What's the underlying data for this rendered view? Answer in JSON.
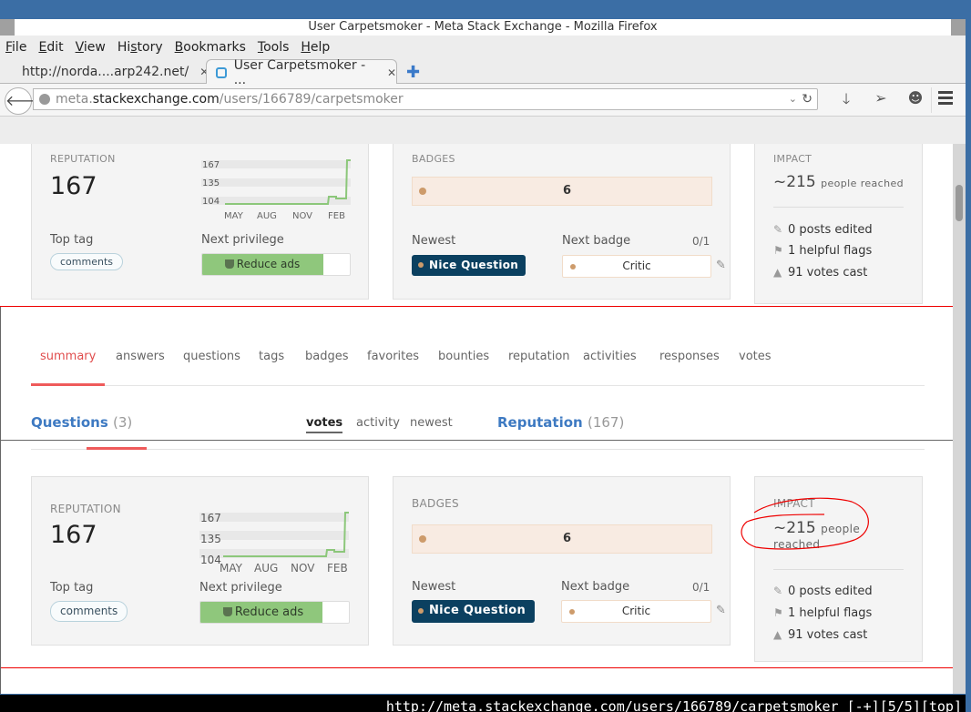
{
  "window": {
    "title": "User Carpetsmoker - Meta Stack Exchange - Mozilla Firefox"
  },
  "menubar": {
    "items": [
      {
        "label": "File",
        "mnemonic": "F",
        "rest": "ile"
      },
      {
        "label": "Edit",
        "mnemonic": "E",
        "rest": "dit"
      },
      {
        "label": "View",
        "mnemonic": "V",
        "rest": "iew"
      },
      {
        "label": "History",
        "pre": "Hi",
        "mnemonic": "s",
        "rest": "tory"
      },
      {
        "label": "Bookmarks",
        "mnemonic": "B",
        "rest": "ookmarks"
      },
      {
        "label": "Tools",
        "mnemonic": "T",
        "rest": "ools"
      },
      {
        "label": "Help",
        "mnemonic": "H",
        "rest": "elp"
      }
    ]
  },
  "tabs": [
    {
      "label": "http://norda....arp242.net/",
      "active": false
    },
    {
      "label": "User Carpetsmoker - ...",
      "active": true,
      "icon": "stackexchange-icon"
    }
  ],
  "navbar": {
    "url_prefix": "meta.",
    "url_host": "stackexchange.com",
    "url_path": "/users/166789/carpetsmoker",
    "icons": [
      "download-icon",
      "send-icon",
      "chat-icon",
      "menu-icon"
    ]
  },
  "profile": {
    "reputation_label": "REPUTATION",
    "reputation": "167",
    "chart": {
      "y_ticks": [
        "167",
        "135",
        "104"
      ],
      "x_ticks": [
        "MAY",
        "AUG",
        "NOV",
        "FEB"
      ]
    },
    "top_tag_label": "Top tag",
    "top_tag": "comments",
    "next_privilege_label": "Next privilege",
    "next_privilege": "Reduce ads",
    "next_privilege_progress": 0.82,
    "badges_label": "BADGES",
    "bronze_count": "6",
    "newest_label": "Newest",
    "newest_badge": "Nice Question",
    "next_badge_label": "Next badge",
    "next_badge_progress": "0/1",
    "next_badge": "Critic",
    "impact_label": "IMPACT",
    "impact_num": "~215",
    "impact_suffix": "people reached",
    "impact_suffix_line1": "people",
    "impact_suffix_line2": "reached",
    "stats": [
      {
        "icon": "pencil-icon",
        "text": "0 posts edited"
      },
      {
        "icon": "flag-icon",
        "text": "1 helpful flags"
      },
      {
        "icon": "triangle-up-icon",
        "text": "91 votes cast"
      }
    ]
  },
  "profile_tabs": [
    "summary",
    "answers",
    "questions",
    "tags",
    "badges",
    "favorites",
    "bounties",
    "reputation",
    "activities",
    "responses",
    "votes"
  ],
  "active_tab": "summary",
  "questions": {
    "title": "Questions",
    "count": "(3)",
    "sorts": [
      "votes",
      "activity",
      "newest"
    ],
    "active_sort": "votes"
  },
  "reputation_section": {
    "title": "Reputation",
    "count": "(167)"
  },
  "colors": {
    "accent_red": "#ef5b5b",
    "link_blue": "#3e7ac2",
    "bronze": "#cd9b6b",
    "privilege_green": "#8fc77c",
    "badge_dark": "#0b4060"
  },
  "statusbar": {
    "text": "http://meta.stackexchange.com/users/166789/carpetsmoker [-+][5/5][top]"
  }
}
